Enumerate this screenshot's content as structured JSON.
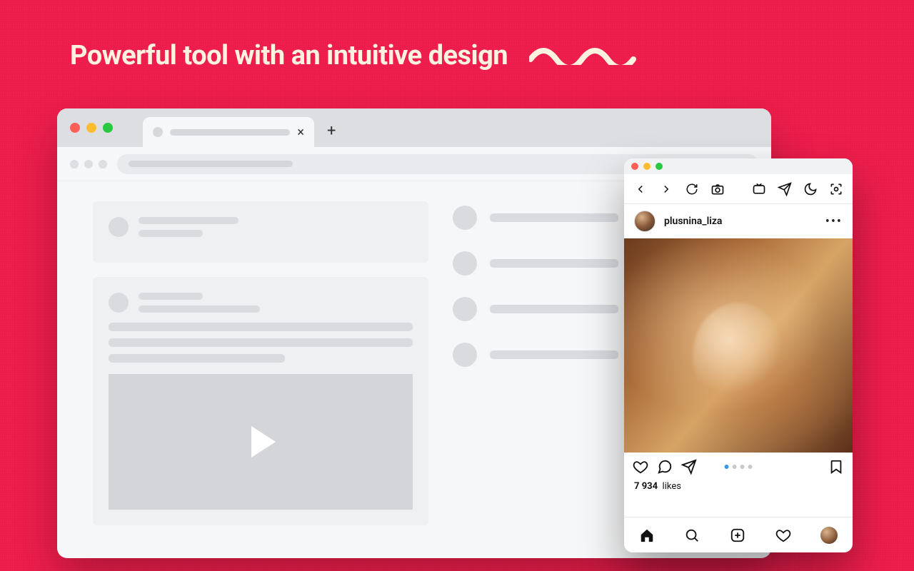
{
  "hero": {
    "title": "Powerful tool  with an intuitive design"
  },
  "app": {
    "post": {
      "username": "plusnina_liza",
      "likes_count": "7 934",
      "likes_label": "likes"
    }
  }
}
